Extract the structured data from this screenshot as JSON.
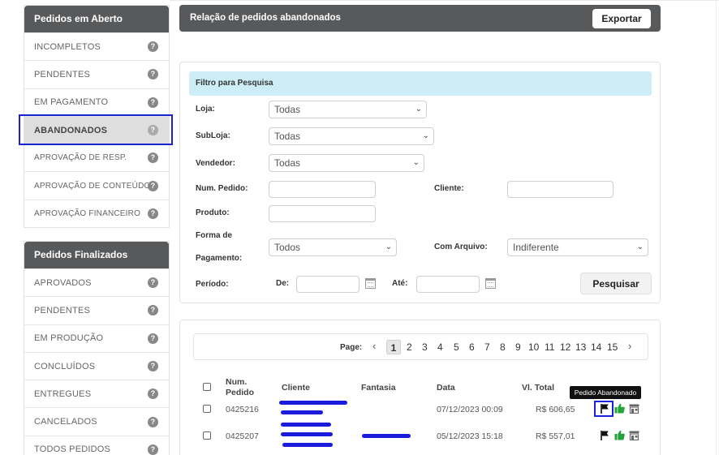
{
  "sidebar": {
    "open_title": "Pedidos em Aberto",
    "open_items": [
      {
        "label": "INCOMPLETOS"
      },
      {
        "label": "PENDENTES"
      },
      {
        "label": "EM PAGAMENTO"
      },
      {
        "label": "ABANDONADOS"
      },
      {
        "label": "APROVAÇÃO DE RESP."
      },
      {
        "label": "APROVAÇÃO DE CONTEÚDO"
      },
      {
        "label": "APROVAÇÃO FINANCEIRO"
      }
    ],
    "closed_title": "Pedidos Finalizados",
    "closed_items": [
      {
        "label": "APROVADOS"
      },
      {
        "label": "PENDENTES"
      },
      {
        "label": "EM PRODUÇÃO"
      },
      {
        "label": "CONCLUÍDOS"
      },
      {
        "label": "ENTREGUES"
      },
      {
        "label": "CANCELADOS"
      },
      {
        "label": "TODOS PEDIDOS"
      }
    ],
    "help_glyph": "?"
  },
  "header": {
    "title": "Relação de pedidos abandonados",
    "export_label": "Exportar"
  },
  "filter": {
    "title": "Filtro para Pesquisa",
    "loja_label": "Loja:",
    "loja_value": "Todas",
    "subloja_label": "SubLoja:",
    "subloja_value": "Todas",
    "vendedor_label": "Vendedor:",
    "vendedor_value": "Todas",
    "num_pedido_label": "Num. Pedido:",
    "cliente_label": "Cliente:",
    "produto_label": "Produto:",
    "forma_pagamento_label_1": "Forma de",
    "forma_pagamento_label_2": "Pagamento:",
    "forma_pagamento_value": "Todos",
    "com_arquivo_label": "Com Arquivo:",
    "com_arquivo_value": "Indiferente",
    "periodo_label": "Período:",
    "de_label": "De:",
    "ate_label": "Até:",
    "search_label": "Pesquisar"
  },
  "pager": {
    "label": "Page:",
    "current": "1",
    "pages": [
      "2",
      "3",
      "4",
      "5",
      "6",
      "7",
      "8",
      "9",
      "10",
      "11",
      "12",
      "13",
      "14",
      "15"
    ],
    "prev": "‹",
    "next": "›"
  },
  "table": {
    "headers": {
      "num_pedido_1": "Num.",
      "num_pedido_2": "Pedido",
      "cliente": "Cliente",
      "fantasia": "Fantasia",
      "data": "Data",
      "valor": "Vl. Total"
    },
    "rows": [
      {
        "num": "0425216",
        "data": "07/12/2023 00:09",
        "valor": "R$ 606,65"
      },
      {
        "num": "0425207",
        "data": "05/12/2023 15:18",
        "valor": "R$ 557,01"
      }
    ]
  },
  "tooltip": "Pedido Abandonado",
  "icons": {
    "flag": "flag-icon",
    "thumbs_up": "thumbs-up-icon",
    "store": "store-icon",
    "help": "help-icon",
    "calendar": "calendar-icon",
    "chevron": "chevron-down-icon"
  },
  "colors": {
    "header_bg": "#58595b",
    "filter_head_bg": "#cdeef6",
    "highlight": "#1a22d6",
    "thumbs_up": "#23a33a"
  }
}
